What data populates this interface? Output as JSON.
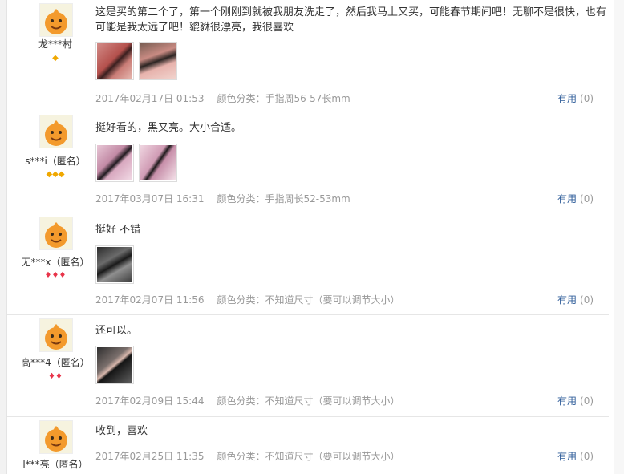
{
  "useful_label": "有用",
  "reviews": [
    {
      "username": "龙***村",
      "level_icons": "◆",
      "level_color": "#f0a800",
      "content": "这是买的第二个了，第一个刚刚到就被我朋友洗走了，然后我马上又买，可能春节期间吧！无聊不是很快，也有可能是我太远了吧！貔貅很漂亮，我很喜欢",
      "date": "2017年02月17日 01:53",
      "spec": "颜色分类：手指周56-57长mm",
      "useful_count": "(0)"
    },
    {
      "username": "s***i（匿名）",
      "level_icons": "◆◆◆",
      "level_color": "#f0a800",
      "content": "挺好看的，黑又亮。大小合适。",
      "date": "2017年03月07日 16:31",
      "spec": "颜色分类：手指周长52-53mm",
      "useful_count": "(0)"
    },
    {
      "username": "无***x（匿名）",
      "level_icons": "♦♦♦",
      "level_color": "#e8344a",
      "content": "挺好 不错",
      "date": "2017年02月07日 11:56",
      "spec": "颜色分类：不知道尺寸（要可以调节大小）",
      "useful_count": "(0)"
    },
    {
      "username": "高***4（匿名）",
      "level_icons": "♦♦",
      "level_color": "#e8344a",
      "content": "还可以。",
      "date": "2017年02月09日 15:44",
      "spec": "颜色分类：不知道尺寸（要可以调节大小）",
      "useful_count": "(0)"
    },
    {
      "username": "l***亮（匿名）",
      "level_icons": "",
      "level_color": "#f0a800",
      "content": "收到，喜欢",
      "date": "2017年02月25日 11:35",
      "spec": "颜色分类：不知道尺寸（要可以调节大小）",
      "useful_count": "(0)"
    }
  ]
}
